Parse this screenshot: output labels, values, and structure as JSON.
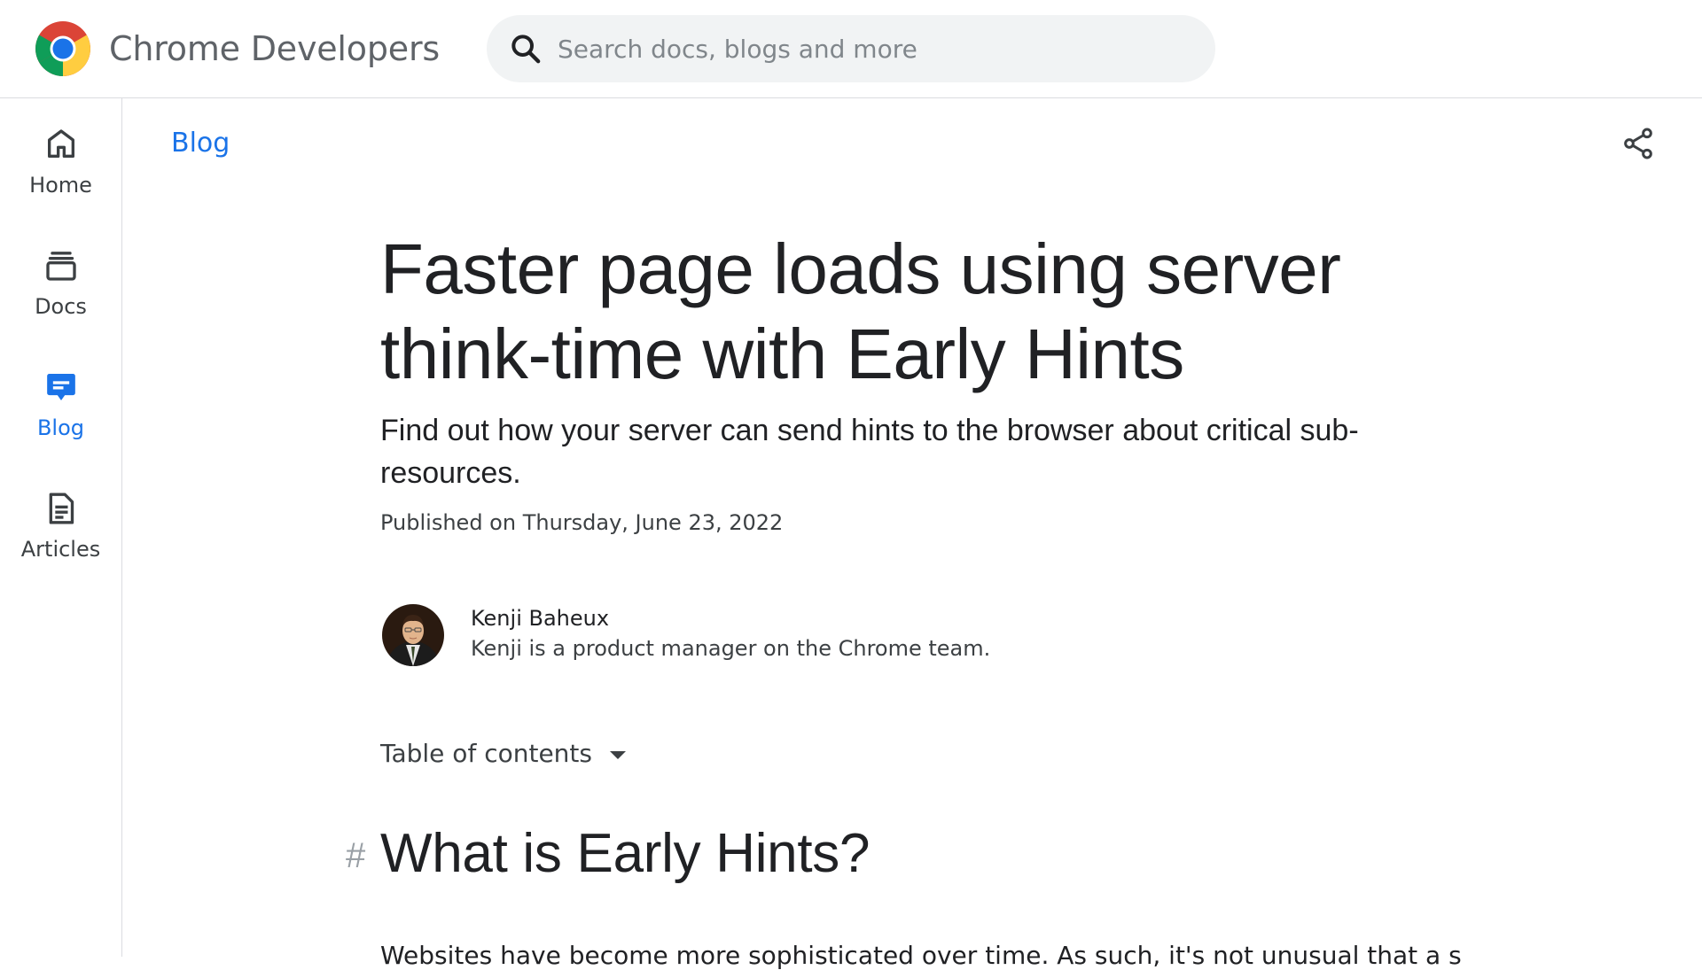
{
  "header": {
    "brand": "Chrome Developers",
    "search_placeholder": "Search docs, blogs and more"
  },
  "rail": {
    "items": [
      {
        "label": "Home",
        "icon": "home-icon"
      },
      {
        "label": "Docs",
        "icon": "docs-icon"
      },
      {
        "label": "Blog",
        "icon": "blog-icon",
        "active": true
      },
      {
        "label": "Articles",
        "icon": "articles-icon"
      }
    ]
  },
  "main": {
    "breadcrumb": "Blog",
    "title": "Faster page loads using server think-time with Early Hints",
    "subtitle": "Find out how your server can send hints to the browser about critical sub-resources.",
    "published": "Published on Thursday, June 23, 2022",
    "author": {
      "name": "Kenji Baheux",
      "bio": "Kenji is a product manager on the Chrome team."
    },
    "toc_label": "Table of contents",
    "section_anchor": "#",
    "section_heading": "What is Early Hints?",
    "body_start": "Websites have become more sophisticated over time. As such, it's not unusual that a server"
  },
  "colors": {
    "accent": "#1a73e8",
    "text": "#202124",
    "muted": "#5f6368",
    "divider": "#dadce0",
    "search_bg": "#f1f3f4"
  }
}
